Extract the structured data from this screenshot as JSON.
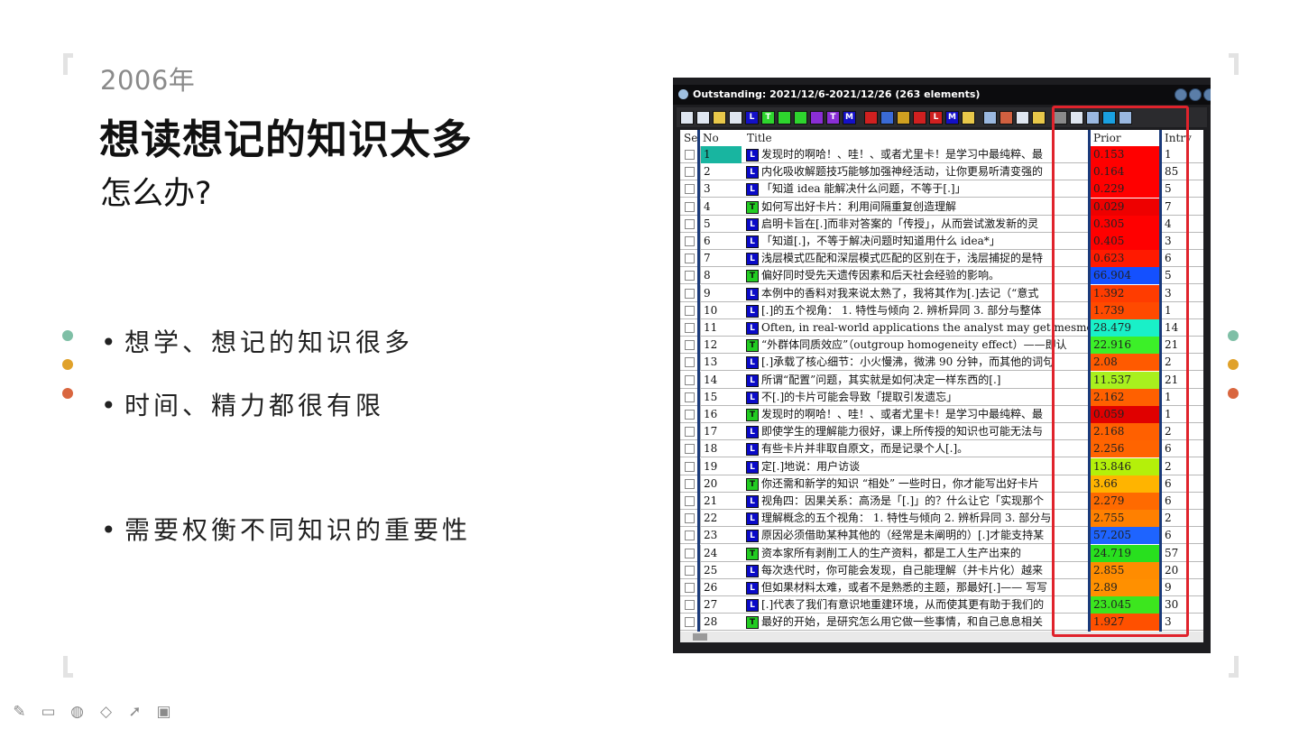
{
  "slide": {
    "year": "2006年",
    "title": "想读想记的知识太多",
    "subtitle": "怎么办?",
    "bullets": [
      "想学、想记的知识很多",
      "时间、精力都很有限",
      "需要权衡不同知识的重要性"
    ],
    "bullet_marker": "•",
    "dot_colors": [
      "#7fbfa6",
      "#e0a12a",
      "#d9663f"
    ]
  },
  "window": {
    "title": "Outstanding: 2021/12/6-2021/12/26 (263 elements)",
    "columns": {
      "se": "Se",
      "no": "No",
      "title": "Title",
      "prior": "Prior",
      "intv": "Intrv"
    },
    "toolbar_icons": [
      "list-icon",
      "doc-icon",
      "books-icon",
      "grid-icon",
      "L-icon",
      "T-icon",
      "check-icon",
      "square-icon",
      "purple-icon",
      "T2-icon",
      "M-icon",
      "eraser-icon",
      "sort-icon",
      "arrow-icon",
      "flag-icon",
      "L2-icon",
      "M2-icon",
      "tiles-icon",
      "window-icon",
      "image-icon",
      "dice-icon",
      "print-icon",
      "binoculars-icon",
      "eye-icon",
      "save-icon",
      "refresh-icon",
      "search-icon"
    ],
    "rows": [
      {
        "no": "1",
        "type": "L",
        "title": "发现时的啊哈！、哇！、或者尤里卡！是学习中最纯粹、最",
        "prior": "0.153",
        "intv": "1",
        "color": "#ff0000",
        "sel": true
      },
      {
        "no": "2",
        "type": "L",
        "title": "内化吸收解题技巧能够加强神经活动，让你更易听清变强的",
        "prior": "0.164",
        "intv": "85",
        "color": "#ff0000"
      },
      {
        "no": "3",
        "type": "L",
        "title": "「知道 idea 能解决什么问题，不等于[.]」",
        "prior": "0.229",
        "intv": "5",
        "color": "#ff0000"
      },
      {
        "no": "4",
        "type": "T",
        "title": "如何写出好卡片：利用间隔重复创造理解",
        "prior": "0.029",
        "intv": "7",
        "color": "#ee0000"
      },
      {
        "no": "5",
        "type": "L",
        "title": "启明卡旨在[.]而非对答案的「传授」，从而尝试激发新的灵",
        "prior": "0.305",
        "intv": "4",
        "color": "#ff0000"
      },
      {
        "no": "6",
        "type": "L",
        "title": "「知道[.]，不等于解决问题时知道用什么 idea*」",
        "prior": "0.405",
        "intv": "3",
        "color": "#ff0000"
      },
      {
        "no": "7",
        "type": "L",
        "title": "浅层模式匹配和深层模式匹配的区别在于，浅层捕捉的是特",
        "prior": "0.623",
        "intv": "6",
        "color": "#ff1a00"
      },
      {
        "no": "8",
        "type": "T",
        "title": "偏好同时受先天遗传因素和后天社会经验的影响。",
        "prior": "66.904",
        "intv": "5",
        "color": "#1450ff"
      },
      {
        "no": "9",
        "type": "L",
        "title": "本例中的香料对我来说太熟了，我将其作为[.]去记（“意式",
        "prior": "1.392",
        "intv": "3",
        "color": "#ff3c00"
      },
      {
        "no": "10",
        "type": "L",
        "title": "[.]的五个视角：  1. 特性与倾向 2. 辨析异同 3. 部分与整体",
        "prior": "1.739",
        "intv": "1",
        "color": "#ff4a00"
      },
      {
        "no": "11",
        "type": "L",
        "title": "Often, in real-world applications the analyst may get mesmerised",
        "prior": "28.479",
        "intv": "14",
        "color": "#19f0c8"
      },
      {
        "no": "12",
        "type": "T",
        "title": "“外群体同质效应”（outgroup homogeneity effect）——即认",
        "prior": "22.916",
        "intv": "21",
        "color": "#3cf028"
      },
      {
        "no": "13",
        "type": "L",
        "title": "[.]承载了核心细节：小火慢沸，微沸 90 分钟，而其他的词句",
        "prior": "2.08",
        "intv": "2",
        "color": "#ff5a00"
      },
      {
        "no": "14",
        "type": "L",
        "title": "所谓“配置”问题，其实就是如何决定一样东西的[.]",
        "prior": "11.537",
        "intv": "21",
        "color": "#a8f01e"
      },
      {
        "no": "15",
        "type": "L",
        "title": "不[.]的卡片可能会导致「提取引发遗忘」",
        "prior": "2.162",
        "intv": "1",
        "color": "#ff6000"
      },
      {
        "no": "16",
        "type": "T",
        "title": "发现时的啊哈！、哇！、或者尤里卡！是学习中最纯粹、最",
        "prior": "0.059",
        "intv": "1",
        "color": "#e00000"
      },
      {
        "no": "17",
        "type": "L",
        "title": "即使学生的理解能力很好，课上所传授的知识也可能无法与",
        "prior": "2.168",
        "intv": "2",
        "color": "#ff6000"
      },
      {
        "no": "18",
        "type": "L",
        "title": "有些卡片并非取自原文，而是记录个人[.]。",
        "prior": "2.256",
        "intv": "6",
        "color": "#ff6400"
      },
      {
        "no": "19",
        "type": "L",
        "title": "定[.]地说：用户访谈",
        "prior": "13.846",
        "intv": "2",
        "color": "#b4f00a"
      },
      {
        "no": "20",
        "type": "T",
        "title": "你还需和新学的知识 “相处” 一些时日，你才能写出好卡片",
        "prior": "3.66",
        "intv": "6",
        "color": "#ffb400"
      },
      {
        "no": "21",
        "type": "L",
        "title": "视角四：因果关系：高汤是「[.]」的？什么让它「实现那个",
        "prior": "2.279",
        "intv": "6",
        "color": "#ff6a00"
      },
      {
        "no": "22",
        "type": "L",
        "title": "理解概念的五个视角：  1. 特性与倾向 2. 辨析异同 3. 部分与",
        "prior": "2.755",
        "intv": "2",
        "color": "#ff8000"
      },
      {
        "no": "23",
        "type": "L",
        "title": "原因必须借助某种其他的（经常是未阐明的）[.]才能支持某",
        "prior": "57.205",
        "intv": "6",
        "color": "#1e64ff"
      },
      {
        "no": "24",
        "type": "T",
        "title": "资本家所有剥削工人的生产资料，都是工人生产出来的",
        "prior": "24.719",
        "intv": "57",
        "color": "#28e01e"
      },
      {
        "no": "25",
        "type": "L",
        "title": "每次迭代时，你可能会发现，自己能理解（并卡片化）越来",
        "prior": "2.855",
        "intv": "20",
        "color": "#ff8c00"
      },
      {
        "no": "26",
        "type": "L",
        "title": "但如果材料太难，或者不是熟悉的主题，那最好[.]—— 写写",
        "prior": "2.89",
        "intv": "9",
        "color": "#ff9000"
      },
      {
        "no": "27",
        "type": "L",
        "title": "[.]代表了我们有意识地重建环境，从而使其更有助于我们的",
        "prior": "23.045",
        "intv": "30",
        "color": "#3ce61e"
      },
      {
        "no": "28",
        "type": "T",
        "title": "最好的开始，是研究怎么用它做一些事情，和自己息息相关",
        "prior": "1.927",
        "intv": "3",
        "color": "#ff5000"
      }
    ]
  },
  "bottom_tools": [
    "pen-icon",
    "window-icon",
    "palette-icon",
    "eraser-icon",
    "cursor-icon",
    "screen-icon"
  ]
}
